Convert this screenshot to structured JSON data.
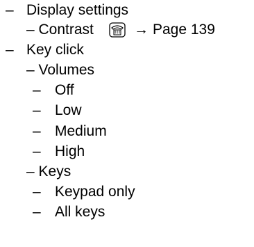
{
  "outline": {
    "dash_long": "–",
    "display_settings": "Display settings",
    "contrast": "– Contrast",
    "contrast_ref": {
      "icon": "phone-icon",
      "arrow": "→",
      "page_text": "Page 139"
    },
    "key_click": "Key click",
    "volumes": "– Volumes",
    "volume_options": [
      "Off",
      "Low",
      "Medium",
      "High"
    ],
    "keys": "– Keys",
    "key_options": [
      "Keypad only",
      "All keys"
    ]
  }
}
